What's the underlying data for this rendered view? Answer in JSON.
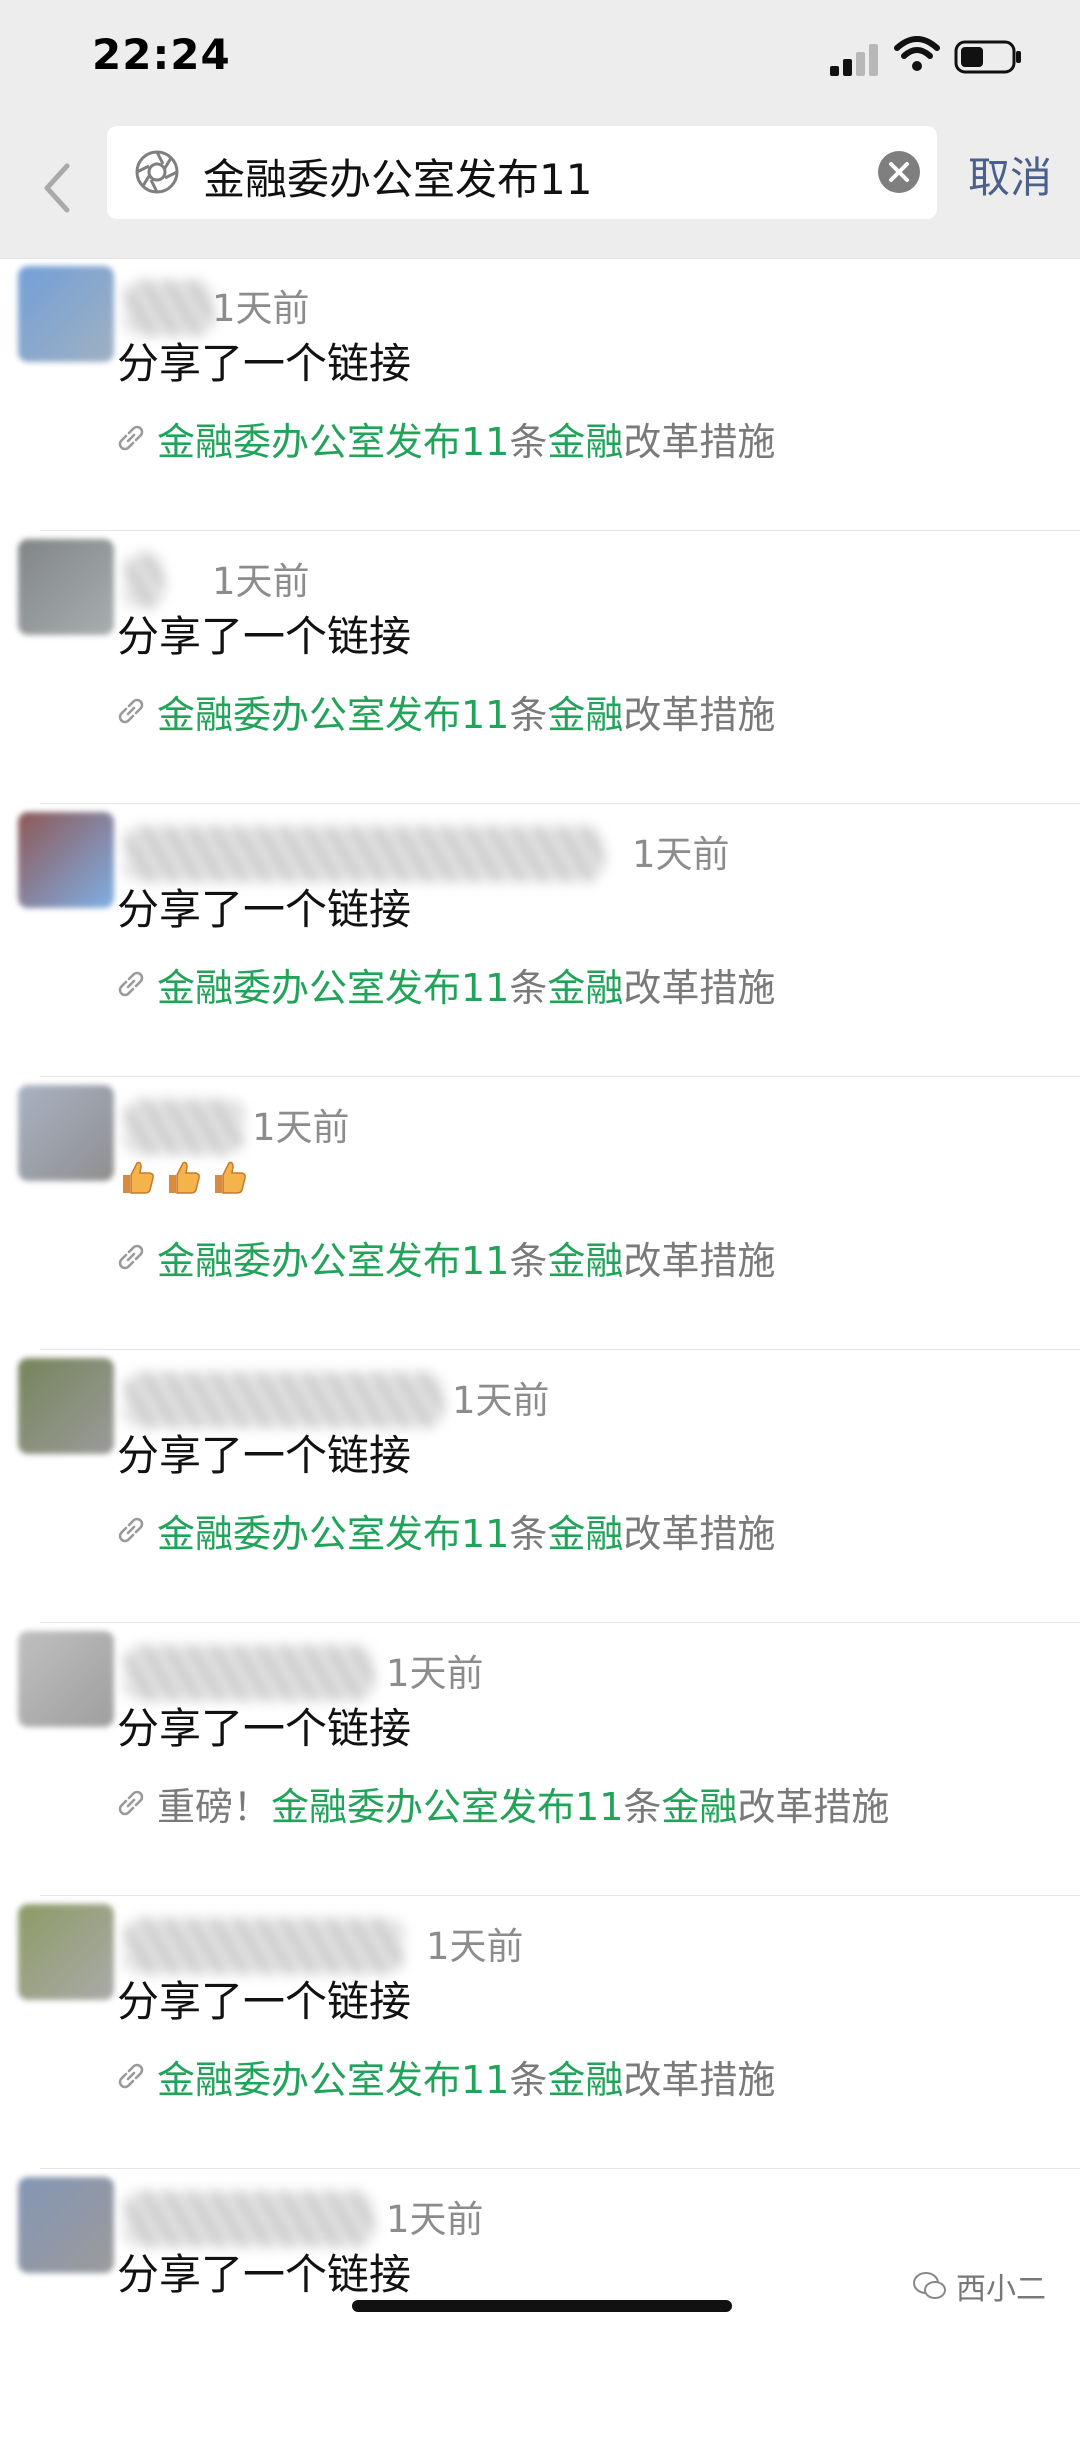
{
  "status_bar": {
    "time": "22:24"
  },
  "search": {
    "query": "金融委办公室发布11",
    "cancel_label": "取消"
  },
  "results": [
    {
      "time_ago": "1天前",
      "text": "分享了一个链接",
      "link": [
        {
          "t": "金融委办公室发布11",
          "hl": true
        },
        {
          "t": "条",
          "hl": false
        },
        {
          "t": "金融",
          "hl": true
        },
        {
          "t": "改革措施",
          "hl": false
        }
      ]
    },
    {
      "time_ago": "1天前",
      "text": "分享了一个链接",
      "link": [
        {
          "t": "金融委办公室发布11",
          "hl": true
        },
        {
          "t": "条",
          "hl": false
        },
        {
          "t": "金融",
          "hl": true
        },
        {
          "t": "改革措施",
          "hl": false
        }
      ]
    },
    {
      "time_ago": "1天前",
      "text": "分享了一个链接",
      "link": [
        {
          "t": "金融委办公室发布11",
          "hl": true
        },
        {
          "t": "条",
          "hl": false
        },
        {
          "t": "金融",
          "hl": true
        },
        {
          "t": "改革措施",
          "hl": false
        }
      ]
    },
    {
      "time_ago": "1天前",
      "emoji": [
        "thumbs-up",
        "thumbs-up",
        "thumbs-up"
      ],
      "link": [
        {
          "t": "金融委办公室发布11",
          "hl": true
        },
        {
          "t": "条",
          "hl": false
        },
        {
          "t": "金融",
          "hl": true
        },
        {
          "t": "改革措施",
          "hl": false
        }
      ]
    },
    {
      "time_ago": "1天前",
      "text": "分享了一个链接",
      "link": [
        {
          "t": "金融委办公室发布11",
          "hl": true
        },
        {
          "t": "条",
          "hl": false
        },
        {
          "t": "金融",
          "hl": true
        },
        {
          "t": "改革措施",
          "hl": false
        }
      ]
    },
    {
      "time_ago": "1天前",
      "text": "分享了一个链接",
      "link": [
        {
          "t": "重磅！",
          "hl": false
        },
        {
          "t": "金融委办公室发布11",
          "hl": true
        },
        {
          "t": "条",
          "hl": false
        },
        {
          "t": "金融",
          "hl": true
        },
        {
          "t": "改革措施",
          "hl": false
        }
      ]
    },
    {
      "time_ago": "1天前",
      "text": "分享了一个链接",
      "link": [
        {
          "t": "金融委办公室发布11",
          "hl": true
        },
        {
          "t": "条",
          "hl": false
        },
        {
          "t": "金融",
          "hl": true
        },
        {
          "t": "改革措施",
          "hl": false
        }
      ]
    },
    {
      "time_ago": "1天前",
      "text": "分享了一个链接",
      "link": []
    }
  ],
  "watermark": "西小二",
  "colors": {
    "highlight": "#21a35a",
    "link_text": "#7a7a7a",
    "cancel": "#4a5f8a",
    "bar_bg": "#ededed"
  }
}
